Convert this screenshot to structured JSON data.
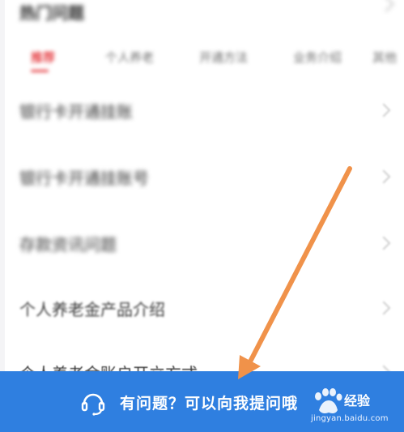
{
  "section": {
    "title": "热门问题"
  },
  "tabs": [
    {
      "label": "推荐"
    },
    {
      "label": "个人养老"
    },
    {
      "label": "开通方法"
    },
    {
      "label": "业务介绍"
    },
    {
      "label": "其他"
    }
  ],
  "list": {
    "items": [
      {
        "label": "银行卡开通挂账"
      },
      {
        "label": "银行卡开通挂账号"
      },
      {
        "label": "存款资讯问题"
      },
      {
        "label": "个人养老金产品介绍"
      },
      {
        "label": "个人养老金账户开立方式"
      }
    ]
  },
  "help": {
    "text": "有问题？可以向我提问哦"
  },
  "watermark": {
    "brand": "经验",
    "url": "jingyan.baidu.com"
  },
  "colors": {
    "accent_red": "#e6454a",
    "help_bar": "#2f7fe0",
    "arrow": "#f0924a"
  }
}
